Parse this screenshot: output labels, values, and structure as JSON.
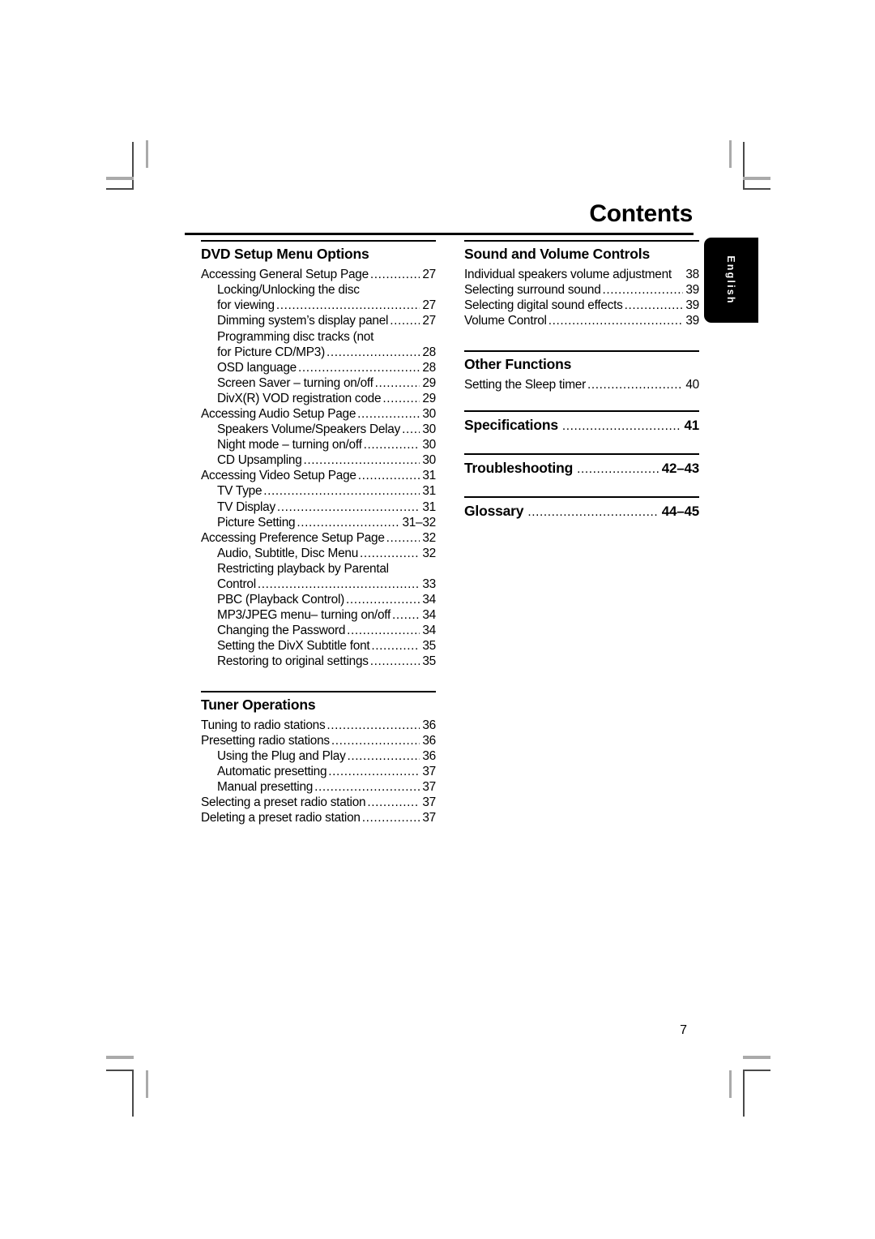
{
  "document": {
    "title": "Contents",
    "page_number": "7",
    "language_tab": "English"
  },
  "left_column": {
    "sections": [
      {
        "heading": "DVD Setup Menu Options",
        "entries": [
          {
            "label": "Accessing General Setup Page",
            "page": "27",
            "level": 0,
            "dots": true
          },
          {
            "label": "Locking/Unlocking the disc",
            "page": "",
            "level": 1,
            "dots": false
          },
          {
            "label": "for viewing",
            "page": "27",
            "level": 1,
            "dots": true
          },
          {
            "label": "Dimming system’s display panel",
            "page": "27",
            "level": 1,
            "dots": true
          },
          {
            "label": "Programming disc tracks (not",
            "page": "",
            "level": 1,
            "dots": false
          },
          {
            "label": "for Picture CD/MP3)",
            "page": "28",
            "level": 1,
            "dots": true
          },
          {
            "label": "OSD language",
            "page": "28",
            "level": 1,
            "dots": true
          },
          {
            "label": "Screen Saver – turning on/off",
            "page": "29",
            "level": 1,
            "dots": true
          },
          {
            "label": "DivX(R) VOD registration code",
            "page": "29",
            "level": 1,
            "dots": true
          },
          {
            "label": "Accessing Audio Setup Page",
            "page": "30",
            "level": 0,
            "dots": true
          },
          {
            "label": "Speakers Volume/Speakers Delay",
            "page": "30",
            "level": 1,
            "dots": true
          },
          {
            "label": "Night mode – turning on/off",
            "page": "30",
            "level": 1,
            "dots": true
          },
          {
            "label": "CD Upsampling",
            "page": "30",
            "level": 1,
            "dots": true
          },
          {
            "label": "Accessing Video Setup Page",
            "page": "31",
            "level": 0,
            "dots": true
          },
          {
            "label": "TV Type",
            "page": "31",
            "level": 1,
            "dots": true
          },
          {
            "label": "TV Display",
            "page": "31",
            "level": 1,
            "dots": true
          },
          {
            "label": "Picture Setting",
            "page": "31–32",
            "level": 1,
            "dots": true
          },
          {
            "label": "Accessing Preference Setup Page",
            "page": "32",
            "level": 0,
            "dots": true
          },
          {
            "label": "Audio, Subtitle, Disc Menu",
            "page": "32",
            "level": 1,
            "dots": true
          },
          {
            "label": "Restricting playback by Parental",
            "page": "",
            "level": 1,
            "dots": false
          },
          {
            "label": "Control",
            "page": "33",
            "level": 1,
            "dots": true
          },
          {
            "label": "PBC (Playback Control)",
            "page": "34",
            "level": 1,
            "dots": true
          },
          {
            "label": "MP3/JPEG menu– turning on/off",
            "page": "34",
            "level": 1,
            "dots": true
          },
          {
            "label": "Changing the Password",
            "page": "34",
            "level": 1,
            "dots": true
          },
          {
            "label": "Setting the DivX Subtitle font",
            "page": "35",
            "level": 1,
            "dots": true
          },
          {
            "label": "Restoring to original settings",
            "page": "35",
            "level": 1,
            "dots": true
          }
        ]
      },
      {
        "heading": "Tuner Operations",
        "entries": [
          {
            "label": "Tuning to radio stations",
            "page": "36",
            "level": 0,
            "dots": true
          },
          {
            "label": "Presetting radio stations",
            "page": "36",
            "level": 0,
            "dots": true
          },
          {
            "label": "Using the Plug and Play",
            "page": "36",
            "level": 1,
            "dots": true
          },
          {
            "label": "Automatic presetting",
            "page": "37",
            "level": 1,
            "dots": true
          },
          {
            "label": "Manual presetting",
            "page": "37",
            "level": 1,
            "dots": true
          },
          {
            "label": "Selecting a preset radio station",
            "page": "37",
            "level": 0,
            "dots": true
          },
          {
            "label": "Deleting a preset radio station",
            "page": "37",
            "level": 0,
            "dots": true
          }
        ]
      }
    ]
  },
  "right_column": {
    "sections": [
      {
        "heading": "Sound and Volume Controls",
        "entries": [
          {
            "label": "Individual speakers volume adjustment",
            "page": "38",
            "level": 0,
            "dots": false
          },
          {
            "label": "Selecting surround sound",
            "page": "39",
            "level": 0,
            "dots": true
          },
          {
            "label": "Selecting digital sound effects",
            "page": "39",
            "level": 0,
            "dots": true
          },
          {
            "label": "Volume Control",
            "page": "39",
            "level": 0,
            "dots": true
          }
        ]
      },
      {
        "heading": "Other Functions",
        "entries": [
          {
            "label": "Setting the Sleep timer",
            "page": "40",
            "level": 0,
            "dots": true
          }
        ]
      }
    ],
    "big_entries": [
      {
        "label": "Specifications",
        "page": "41"
      },
      {
        "label": "Troubleshooting",
        "page": "42–43"
      },
      {
        "label": "Glossary",
        "page": "44–45"
      }
    ]
  }
}
